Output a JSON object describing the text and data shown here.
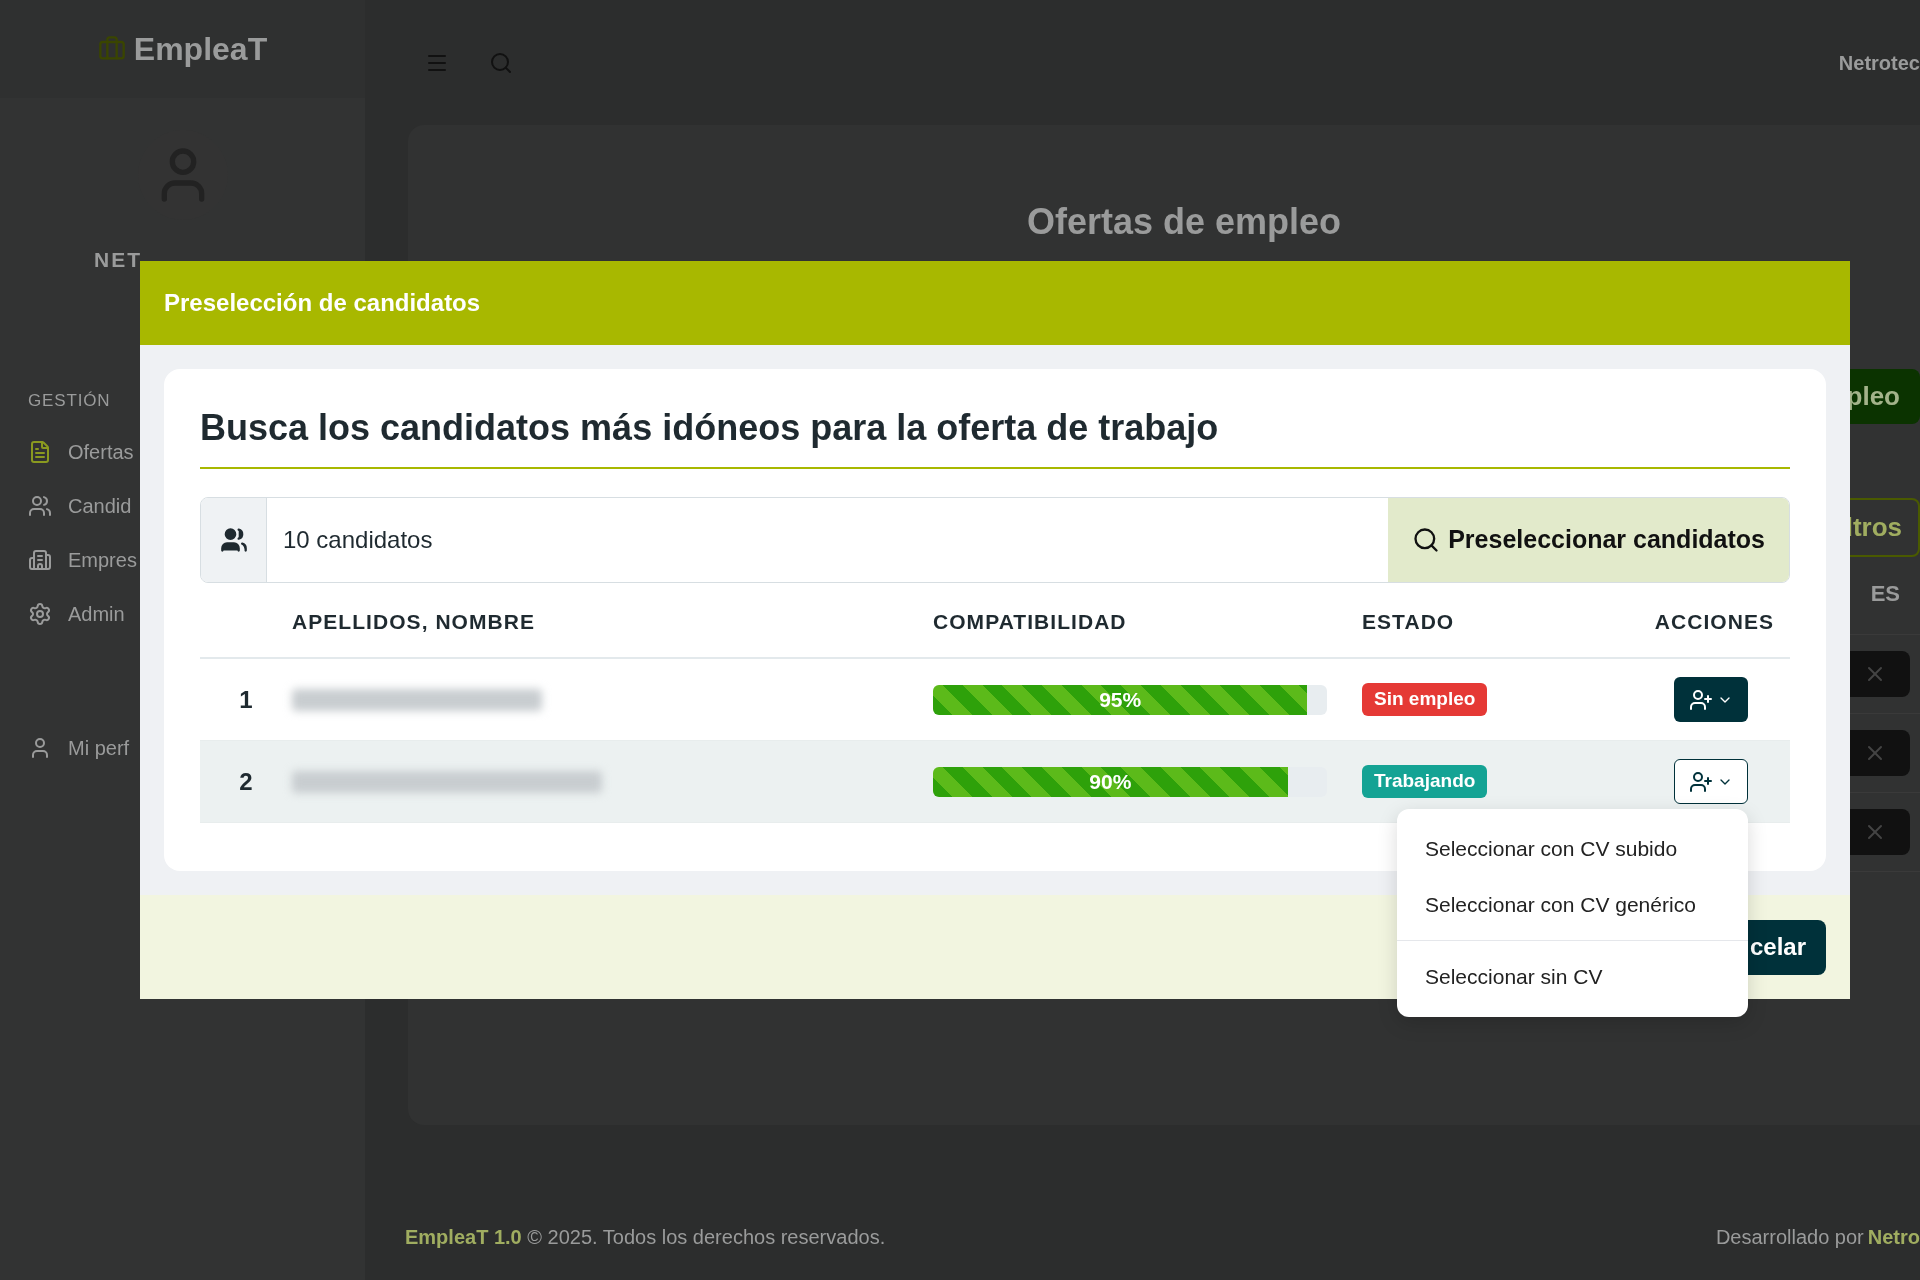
{
  "brand": {
    "name": "EmpleaT"
  },
  "sidebar": {
    "user_name": "NET",
    "section": "GESTIÓN",
    "items": [
      {
        "label": "Ofertas",
        "kind": "file",
        "selected": true
      },
      {
        "label": "Candid",
        "kind": "users",
        "selected": false
      },
      {
        "label": "Empres",
        "kind": "building",
        "selected": false
      },
      {
        "label": "Admin",
        "kind": "gear",
        "selected": false
      }
    ],
    "account_items": [
      {
        "label": "Mi perf",
        "kind": "user",
        "selected": false
      }
    ]
  },
  "topbar": {
    "user": "Netrotec"
  },
  "page": {
    "title": "Ofertas de empleo",
    "new_button": "pleo",
    "filter_button": "ltros",
    "column_heading": "ES"
  },
  "modal": {
    "title": "Preselección de candidatos",
    "heading": "Busca los candidatos más idóneos para la oferta de trabajo",
    "count": "10 candidatos",
    "search_button": "Preseleccionar candidatos",
    "columns": [
      "APELLIDOS, NOMBRE",
      "COMPATIBILIDAD",
      "ESTADO",
      "ACCIONES"
    ],
    "rows": [
      {
        "index": "1",
        "level": 0.95,
        "reading": "95%",
        "status": "Sin empleo",
        "color": "#e53935",
        "menu_open": false
      },
      {
        "index": "2",
        "level": 0.9,
        "reading": "90%",
        "status": "Trabajando",
        "color": "#14a394",
        "menu_open": true
      }
    ],
    "menu": [
      {
        "label": "Seleccionar con CV subido",
        "separated": false
      },
      {
        "label": "Seleccionar con CV genérico",
        "separated": false
      },
      {
        "label": "Seleccionar sin CV",
        "separated": true
      }
    ],
    "cancel_button": "celar"
  },
  "footer": {
    "brand": "EmpleaT 1.0",
    "text": "© 2025. Todos los derechos reservados.",
    "credit": "Desarrollado por",
    "credit_link": "Netro"
  }
}
